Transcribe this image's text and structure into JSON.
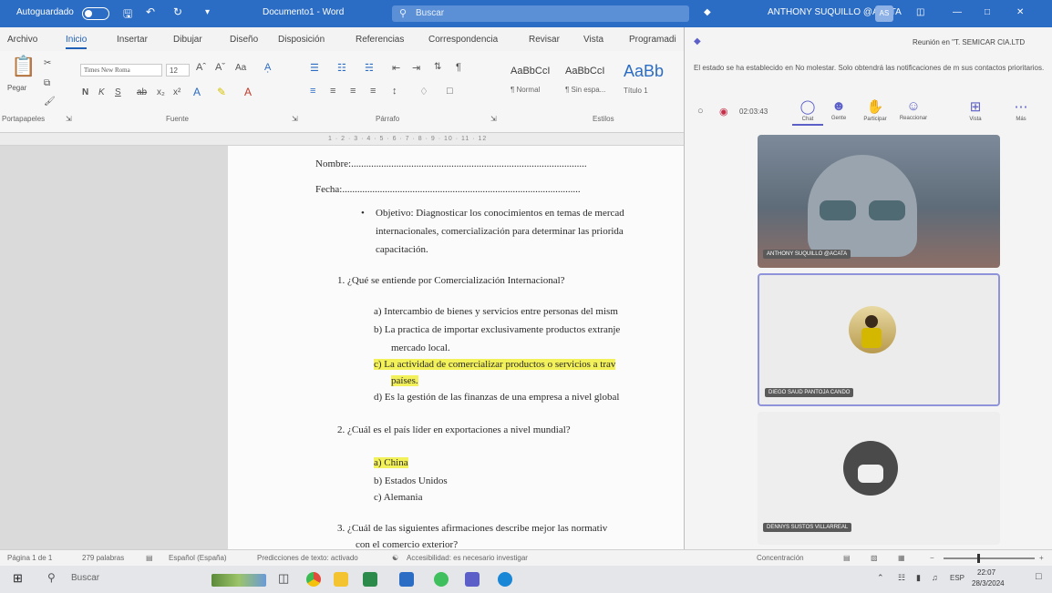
{
  "word": {
    "autosave_label": "Autoguardado",
    "doc_title": "Documento1 - Word",
    "search_placeholder": "Buscar",
    "user_name": "ANTHONY SUQUILLO @ACATA",
    "user_initials": "AS",
    "menu_tabs": [
      "Archivo",
      "Inicio",
      "Insertar",
      "Dibujar",
      "Diseño",
      "Disposición",
      "Referencias",
      "Correspondencia",
      "Revisar",
      "Vista",
      "Programadi"
    ],
    "ribbon": {
      "paste_label": "Pegar",
      "font_name": "Times New Roma",
      "font_size": "12",
      "groups": [
        "Portapapeles",
        "Fuente",
        "Párrafo",
        "Estilos"
      ],
      "styles": [
        {
          "sample": "AaBbCcI",
          "name": "¶ Normal"
        },
        {
          "sample": "AaBbCcI",
          "name": "¶ Sin espa..."
        },
        {
          "sample": "AaBb",
          "name": "Título 1"
        }
      ]
    },
    "ruler_scale": "1 · 2 · 3 · 4 · 5 · 6 · 7 · 8 · 9 · 10 · 11 · 12",
    "document": {
      "nombre": "Nombre:..............................................................................................",
      "fecha": "Fecha:...............................................................................................",
      "objetivo_1": "Objetivo: Diagnosticar los conocimientos en temas de mercad",
      "objetivo_2": "internacionales, comercialización para determinar las priorida",
      "objetivo_3": "capacitación.",
      "q1": "1.  ¿Qué se entiende por Comercialización Internacional?",
      "q1_a": "a)  Intercambio de bienes y servicios entre personas del mism",
      "q1_b1": "b)  La practica de importar exclusivamente productos extranje",
      "q1_b2": "mercado local.",
      "q1_c1": "c)  La actividad de comercializar productos o servicios a trav",
      "q1_c2": "países.",
      "q1_d": "d)  Es la gestión de las finanzas de una empresa a nivel global",
      "q2": "2.  ¿Cuál es el país líder en exportaciones a nivel mundial?",
      "q2_a": "a)  China",
      "q2_b": "b)  Estados Unidos",
      "q2_c": "c)  Alemania",
      "q3_1": "3.  ¿Cuál de las siguientes afirmaciones describe mejor las normativ",
      "q3_2": "con el comercio exterior?"
    },
    "status": {
      "page": "Página 1 de 1",
      "words": "279 palabras",
      "language": "Español (España)",
      "text_predictions": "Predicciones de texto: activado",
      "accessibility": "Accesibilidad: es necesario investigar",
      "focus": "Concentración",
      "zoom_fraction": 0.38
    }
  },
  "teams": {
    "meeting_title": "Reunión en \"T. SEMICAR CIA.LTD",
    "notice": "El estado se ha establecido en No molestar. Solo obtendrá las notificaciones de m sus contactos prioritarios.",
    "timer": "02:03:43",
    "toolbar": [
      "Chat",
      "Gente",
      "Participar",
      "Reaccionar",
      "Vista",
      "Más"
    ],
    "participants": [
      {
        "name": "ANTHONY SUQUILLO @ACATA"
      },
      {
        "name": "DIEGO SAUD PANTOJA CANDO"
      },
      {
        "name": "DENNYS SUSTOS VILLARREAL"
      }
    ]
  },
  "taskbar": {
    "search": "Buscar",
    "language": "ESP",
    "time": "22:07",
    "date": "28/3/2024"
  }
}
